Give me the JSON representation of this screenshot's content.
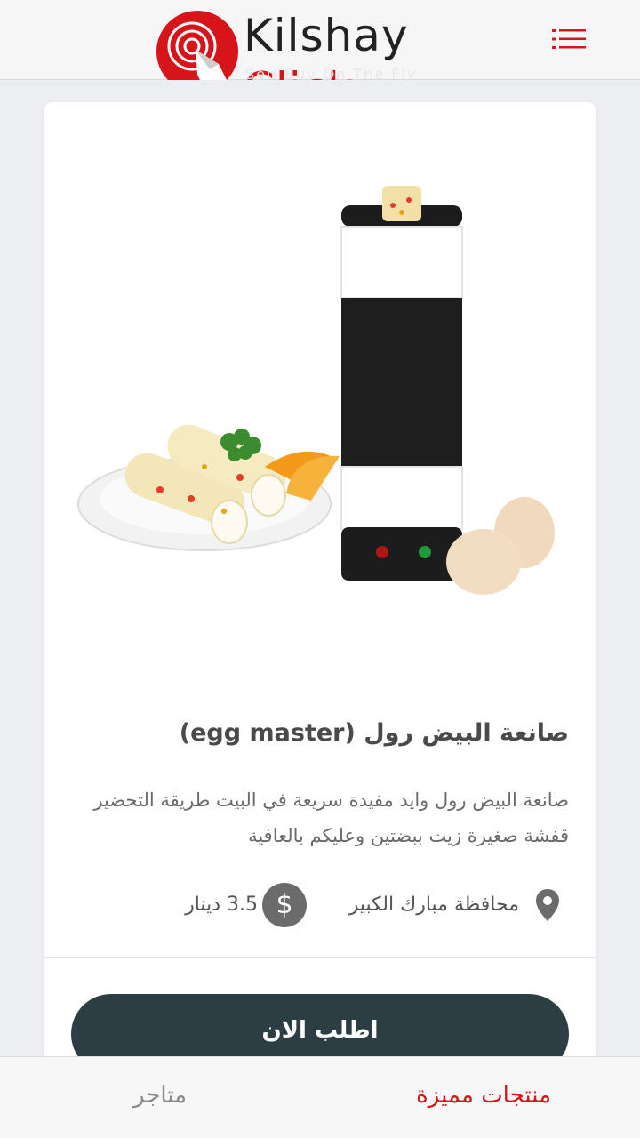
{
  "header": {
    "logo_word1": "Kilshay",
    "logo_word2": "Click",
    "logo_tagline": "Sell Buy On The Fly"
  },
  "product": {
    "title": "صانعة البيض رول (egg master)",
    "description": "صانعة البيض رول وايد مفيدة سريعة في البيت طريقة التحضير قفشة صغيرة زيت ببضتين وعليكم بالعافية",
    "location": "محافظة مبارك الكبير",
    "price": "3.5 دينار",
    "price_symbol": "$",
    "order_button": "اطلب الان"
  },
  "bottom_nav": {
    "featured": "منتجات مميزة",
    "stores": "متاجر"
  },
  "colors": {
    "brand_red": "#d8141b",
    "button_dark": "#2c3e44",
    "background": "#eceef1"
  },
  "icons": {
    "menu": "list-menu-icon",
    "location": "map-pin-icon",
    "price": "dollar-icon"
  }
}
